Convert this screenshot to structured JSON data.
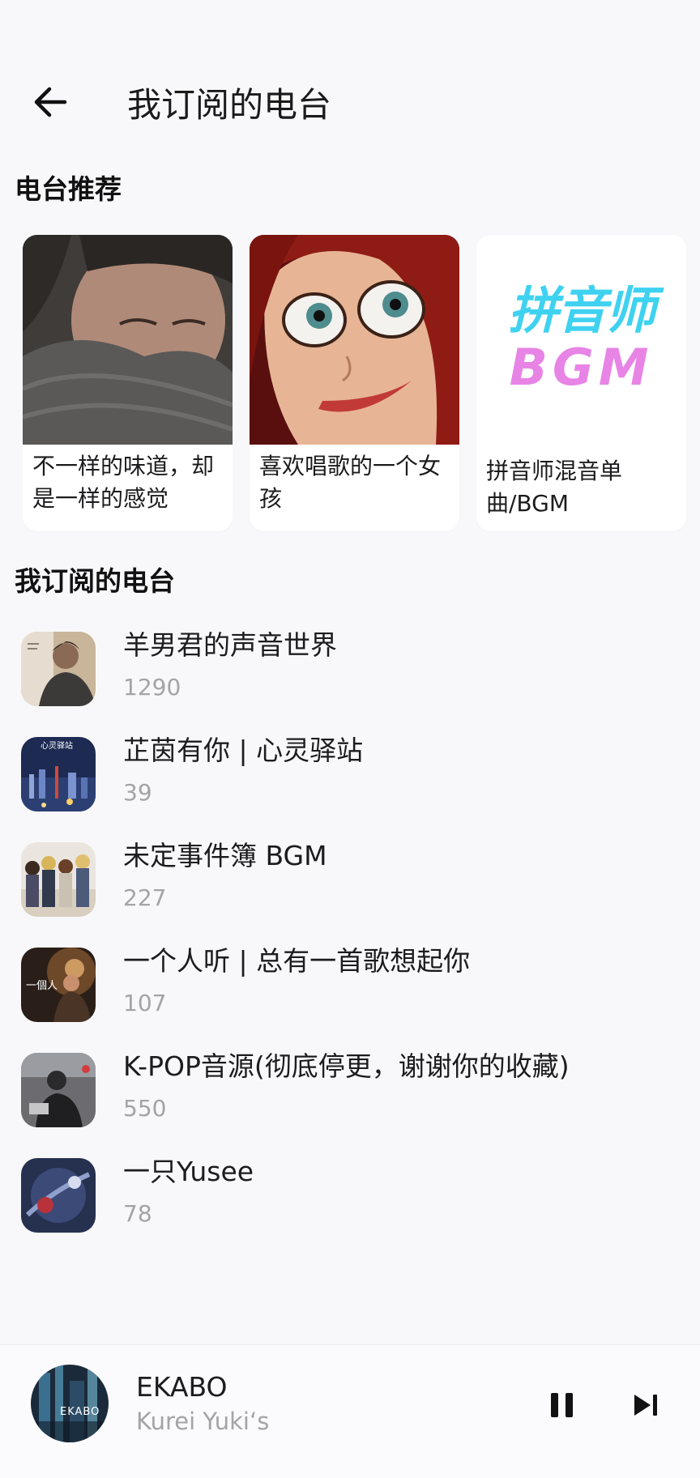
{
  "header": {
    "title": "我订阅的电台",
    "back_icon": "arrow-left-icon"
  },
  "recommend": {
    "section_title": "电台推荐",
    "cards": [
      {
        "title": "不一样的味道，却是一样的感觉",
        "cover": "portrait-sleeping-man"
      },
      {
        "title": "喜欢唱歌的一个女孩",
        "cover": "cartoon-red-hair-girl"
      },
      {
        "title": "拼音师混音单曲/BGM",
        "cover_text_1": "拼音师",
        "cover_text_2": "BGM"
      }
    ]
  },
  "subscribed": {
    "section_title": "我订阅的电台",
    "items": [
      {
        "name": "羊男君的声音世界",
        "count": "1290"
      },
      {
        "name": "芷茵有你 | 心灵驿站",
        "count": "39",
        "cover_text": "心灵驿站"
      },
      {
        "name": "未定事件簿 BGM",
        "count": "227"
      },
      {
        "name": "一个人听 | 总有一首歌想起你",
        "count": "107",
        "cover_text": "一個人"
      },
      {
        "name": "K-POP音源(彻底停更，谢谢你的收藏)",
        "count": "550"
      },
      {
        "name": "一只Yusee",
        "count": "78"
      }
    ]
  },
  "player": {
    "title": "EKABO",
    "artist": "Kurei Yuki‘s",
    "cover_text": "EKABO",
    "pause_icon": "pause-icon",
    "next_icon": "skip-next-icon"
  },
  "colors": {
    "background": "#f8f8fa",
    "text_primary": "#1c1c1e",
    "text_secondary": "#a3a3a8",
    "card_bg": "#ffffff"
  }
}
